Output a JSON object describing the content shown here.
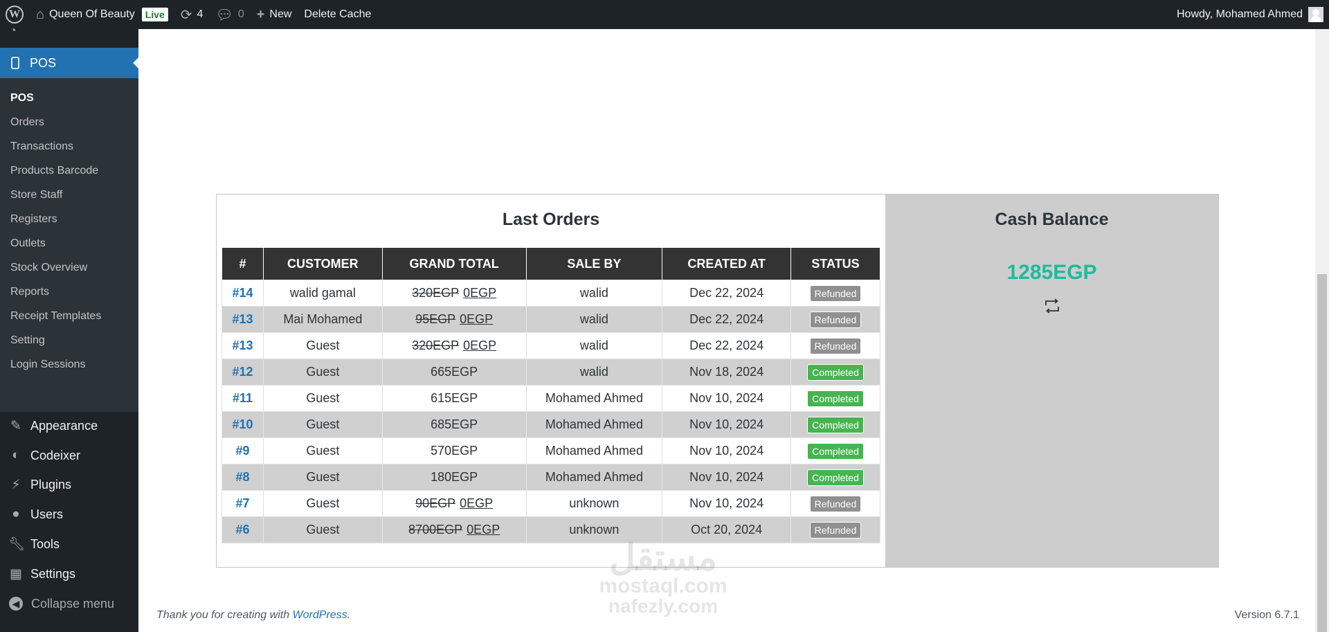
{
  "adminbar": {
    "site_name": "Queen Of Beauty",
    "live_badge": "Live",
    "updates_count": "4",
    "comments_count": "0",
    "new_label": "New",
    "delete_cache_label": "Delete Cache",
    "howdy": "Howdy, Mohamed Ahmed"
  },
  "sidebar": {
    "pos_label": "POS",
    "submenu": [
      "POS",
      "Orders",
      "Transactions",
      "Products Barcode",
      "Store Staff",
      "Registers",
      "Outlets",
      "Stock Overview",
      "Reports",
      "Receipt Templates",
      "Setting",
      "Login Sessions"
    ],
    "menu": [
      {
        "label": "Appearance",
        "icon": "paintbrush-icon"
      },
      {
        "label": "Codeixer",
        "icon": "codeixer-icon"
      },
      {
        "label": "Plugins",
        "icon": "plugin-icon"
      },
      {
        "label": "Users",
        "icon": "users-icon"
      },
      {
        "label": "Tools",
        "icon": "wrench-icon"
      },
      {
        "label": "Settings",
        "icon": "settings-icon"
      }
    ],
    "collapse_label": "Collapse menu"
  },
  "orders": {
    "title": "Last Orders",
    "columns": [
      "#",
      "CUSTOMER",
      "GRAND TOTAL",
      "SALE BY",
      "CREATED AT",
      "STATUS"
    ],
    "rows": [
      {
        "id": "#14",
        "customer": "walid gamal",
        "total_old": "320EGP",
        "total": "0EGP",
        "sale_by": "walid",
        "created": "Dec 22, 2024",
        "status": "Refunded"
      },
      {
        "id": "#13",
        "customer": "Mai Mohamed",
        "total_old": "95EGP",
        "total": "0EGP",
        "sale_by": "walid",
        "created": "Dec 22, 2024",
        "status": "Refunded"
      },
      {
        "id": "#13",
        "customer": "Guest",
        "total_old": "320EGP",
        "total": "0EGP",
        "sale_by": "walid",
        "created": "Dec 22, 2024",
        "status": "Refunded"
      },
      {
        "id": "#12",
        "customer": "Guest",
        "total_old": "",
        "total": "665EGP",
        "sale_by": "walid",
        "created": "Nov 18, 2024",
        "status": "Completed"
      },
      {
        "id": "#11",
        "customer": "Guest",
        "total_old": "",
        "total": "615EGP",
        "sale_by": "Mohamed Ahmed",
        "created": "Nov 10, 2024",
        "status": "Completed"
      },
      {
        "id": "#10",
        "customer": "Guest",
        "total_old": "",
        "total": "685EGP",
        "sale_by": "Mohamed Ahmed",
        "created": "Nov 10, 2024",
        "status": "Completed"
      },
      {
        "id": "#9",
        "customer": "Guest",
        "total_old": "",
        "total": "570EGP",
        "sale_by": "Mohamed Ahmed",
        "created": "Nov 10, 2024",
        "status": "Completed"
      },
      {
        "id": "#8",
        "customer": "Guest",
        "total_old": "",
        "total": "180EGP",
        "sale_by": "Mohamed Ahmed",
        "created": "Nov 10, 2024",
        "status": "Completed"
      },
      {
        "id": "#7",
        "customer": "Guest",
        "total_old": "90EGP",
        "total": "0EGP",
        "sale_by": "unknown",
        "created": "Nov 10, 2024",
        "status": "Refunded"
      },
      {
        "id": "#6",
        "customer": "Guest",
        "total_old": "8700EGP",
        "total": "0EGP",
        "sale_by": "unknown",
        "created": "Oct 20, 2024",
        "status": "Refunded"
      }
    ]
  },
  "cash": {
    "title": "Cash Balance",
    "amount": "1285EGP",
    "refresh_icon": "refresh-icon"
  },
  "footer": {
    "thanks_prefix": "Thank you for creating with ",
    "wordpress_link": "WordPress",
    "thanks_suffix": ".",
    "version": "Version 6.7.1"
  },
  "watermark": {
    "line1": "مستقل",
    "line2": "mostaql.com",
    "line3": "nafezly.com"
  },
  "colors": {
    "admin_bar": "#1d2327",
    "active_menu": "#2271b1",
    "completed": "#46b450",
    "refunded": "#909090",
    "cash_amount": "#1abc9c"
  }
}
